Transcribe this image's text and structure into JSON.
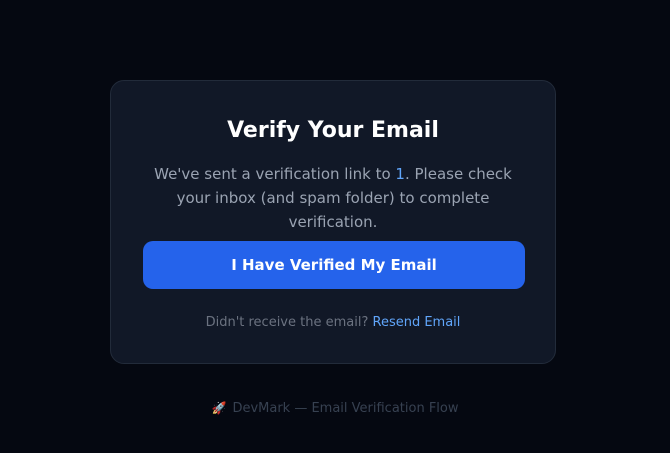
{
  "card": {
    "title": "Verify Your Email",
    "message_before": "We've sent a verification link to ",
    "email": "1",
    "message_after": ". Please check your inbox (and spam folder) to complete verification.",
    "verify_button_label": "I Have Verified My Email",
    "resend_prompt": "Didn't receive the email?",
    "resend_link_label": "Resend Email"
  },
  "footer": {
    "icon": "rocket-icon",
    "text": "DevMark — Email Verification Flow"
  },
  "colors": {
    "background": "#050811",
    "card": "#111827",
    "accent": "#2563eb",
    "link": "#60a5fa"
  }
}
